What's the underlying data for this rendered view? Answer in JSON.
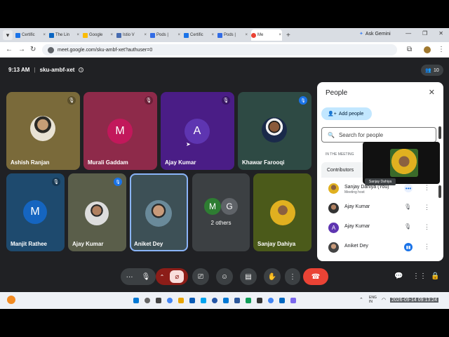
{
  "browser": {
    "tabs": [
      {
        "label": "Certific",
        "color": "#1a73e8"
      },
      {
        "label": "The Lin",
        "color": "#0a66c2"
      },
      {
        "label": "Google",
        "color": "#fbbc04"
      },
      {
        "label": "Istio V",
        "color": "#466bb0"
      },
      {
        "label": "Pods |",
        "color": "#326ce5"
      },
      {
        "label": "Certific",
        "color": "#1a73e8"
      },
      {
        "label": "Pods |",
        "color": "#326ce5"
      },
      {
        "label": "Me",
        "color": "#ea4335"
      }
    ],
    "ask_gemini": "Ask Gemini",
    "url": "meet.google.com/sku-ambf-xet?authuser=0"
  },
  "meeting": {
    "time": "9:13 AM",
    "code": "sku-ambf-xet",
    "participant_count": "10"
  },
  "tiles": [
    {
      "name": "Ashish Ranjan",
      "bg": "#7a6a3a"
    },
    {
      "name": "Murali Gaddam",
      "initial": "M",
      "bg": "#8e2a4a",
      "avatar": "#c2185b"
    },
    {
      "name": "Ajay Kumar",
      "initial": "A",
      "bg": "#4a1d86",
      "avatar": "#5e35b1"
    },
    {
      "name": "Khawar Farooqi",
      "bg": "#2e4a44"
    },
    {
      "name": "Manjit Rathee",
      "initial": "M",
      "bg": "#1e4a6e",
      "avatar": "#1565c0"
    },
    {
      "name": "Ajay Kumar",
      "bg": "#5a5e4a"
    },
    {
      "name": "Aniket Dey",
      "bg": "#3d5056"
    },
    {
      "name": "2 others",
      "initials": [
        "M",
        "G"
      ]
    },
    {
      "name": "Sanjay Dahiya",
      "bg": "#4b5a1a"
    }
  ],
  "people_panel": {
    "title": "People",
    "add_people": "Add people",
    "search_placeholder": "Search for people",
    "section_label": "IN THE MEETING",
    "contributors_label": "Contributors",
    "hover_tooltip": "Sanjay Dahiya",
    "rows": [
      {
        "name": "Sanjay Dahiya (You)",
        "sub": "Meeting host"
      },
      {
        "name": "Ajay Kumar"
      },
      {
        "name": "Ajay Kumar",
        "initial": "A"
      },
      {
        "name": "Aniket Dey"
      }
    ]
  },
  "taskbar": {
    "lang_top": "ENG",
    "lang_bottom": "IN",
    "datetime": "2026-09-14 09:13:24"
  }
}
